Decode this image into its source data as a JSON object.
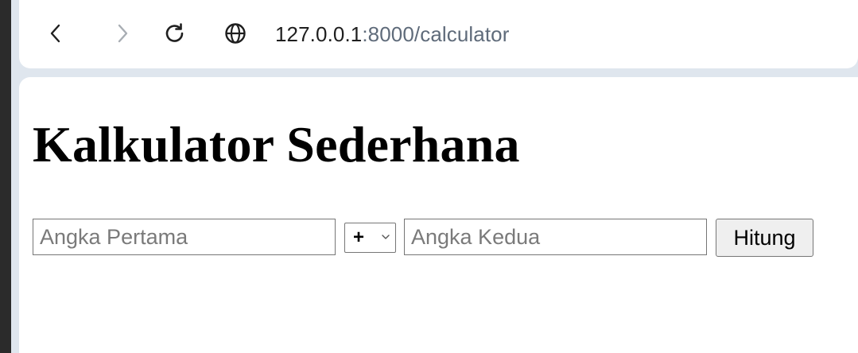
{
  "browser": {
    "url_host": "127.0.0.1",
    "url_rest": ":8000/calculator",
    "icons": [
      "back-arrow-icon",
      "forward-arrow-icon",
      "reload-icon",
      "globe-icon"
    ]
  },
  "page": {
    "title": "Kalkulator Sederhana",
    "form": {
      "first_input": {
        "value": "",
        "placeholder": "Angka Pertama"
      },
      "operator": {
        "selected": "+"
      },
      "second_input": {
        "value": "",
        "placeholder": "Angka Kedua"
      },
      "submit_label": "Hitung"
    }
  }
}
